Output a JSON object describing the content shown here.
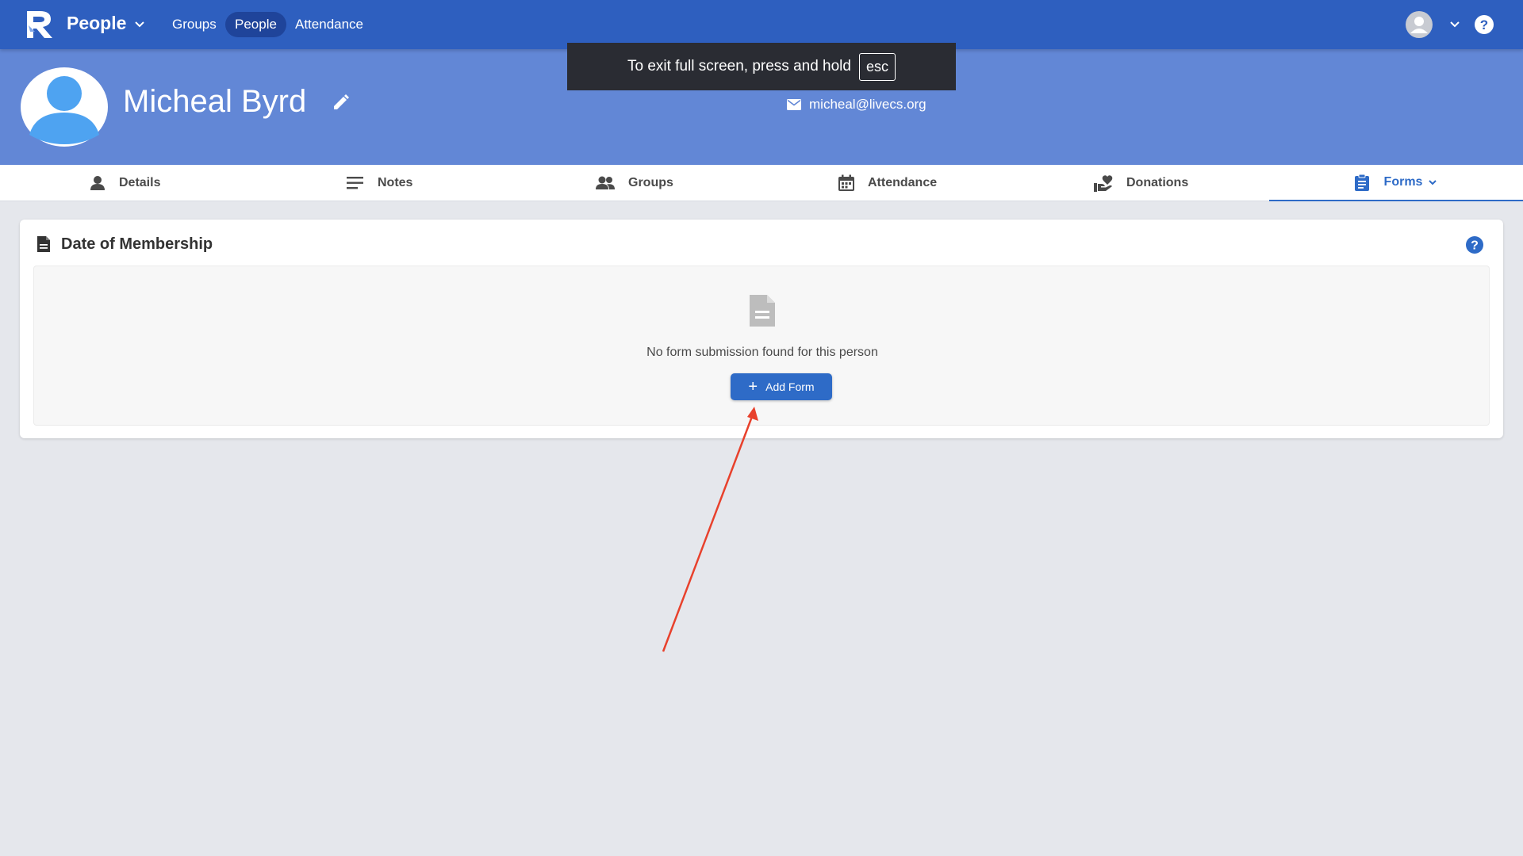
{
  "topbar": {
    "app_title": "People",
    "nav": [
      "Groups",
      "People",
      "Attendance"
    ],
    "active_nav": "People"
  },
  "toast": {
    "text": "To exit full screen, press and hold",
    "key": "esc"
  },
  "profile": {
    "name": "Micheal Byrd",
    "email": "micheal@livecs.org"
  },
  "tabs": [
    {
      "label": "Details",
      "icon": "person-icon"
    },
    {
      "label": "Notes",
      "icon": "notes-icon"
    },
    {
      "label": "Groups",
      "icon": "groups-icon"
    },
    {
      "label": "Attendance",
      "icon": "calendar-icon"
    },
    {
      "label": "Donations",
      "icon": "donations-icon"
    },
    {
      "label": "Forms",
      "icon": "clipboard-icon"
    }
  ],
  "active_tab": "Forms",
  "card": {
    "title": "Date of Membership",
    "empty_message": "No form submission found for this person",
    "add_button": "Add Form"
  },
  "colors": {
    "topbar": "#2e5fbf",
    "profile_header": "#6287d6",
    "accent": "#2e6bc7",
    "annotation_arrow": "#e8412c"
  }
}
